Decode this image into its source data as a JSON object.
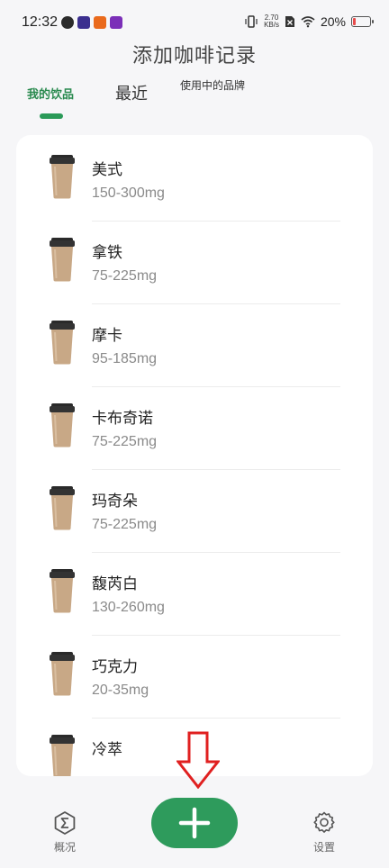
{
  "status_bar": {
    "time": "12:32",
    "net_speed_value": "2.70",
    "net_speed_unit": "KB/s",
    "battery_text": "20%",
    "battery_level": 0.2,
    "app_icon_colors": [
      "#2b2b2b",
      "#3b2f8f",
      "#ea6a1c",
      "#7b2fb8"
    ]
  },
  "header": {
    "title": "添加咖啡记录"
  },
  "tabs": [
    {
      "label": "我的饮品",
      "active": true
    },
    {
      "label": "最近",
      "active": false
    },
    {
      "label": "使用中的品牌",
      "active": false
    }
  ],
  "drinks": [
    {
      "name": "美式",
      "range": "150-300mg"
    },
    {
      "name": "拿铁",
      "range": "75-225mg"
    },
    {
      "name": "摩卡",
      "range": "95-185mg"
    },
    {
      "name": "卡布奇诺",
      "range": "75-225mg"
    },
    {
      "name": "玛奇朵",
      "range": "75-225mg"
    },
    {
      "name": "馥芮白",
      "range": "130-260mg"
    },
    {
      "name": "巧克力",
      "range": "20-35mg"
    },
    {
      "name": "冷萃",
      "range": ""
    }
  ],
  "bottom_nav": {
    "overview_label": "概况",
    "settings_label": "设置",
    "overview_icon": "sigma-icon",
    "add_icon": "plus-icon",
    "settings_icon": "gear-icon"
  },
  "colors": {
    "accent": "#2e9b5c",
    "tab_active": "#2a8a4f",
    "arrow": "#e02020",
    "cup": "#c8a886",
    "lid": "#2a2a2a"
  }
}
